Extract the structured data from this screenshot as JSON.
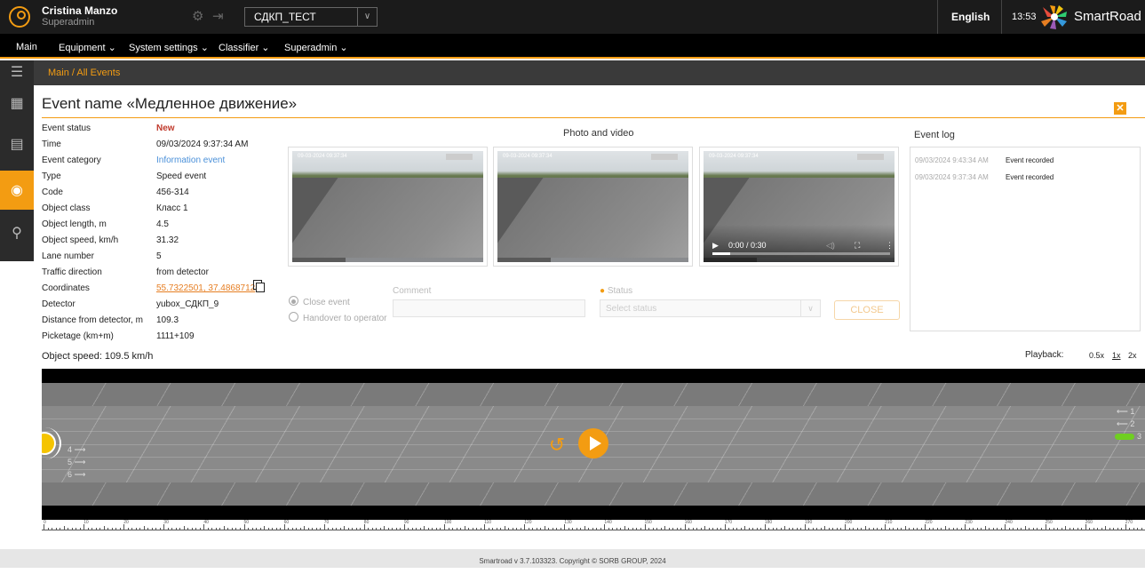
{
  "topbar": {
    "user_name": "Cristina Manzo",
    "user_role": "Superadmin",
    "project": "СДКП_ТЕСТ",
    "language": "English",
    "time": "13:53",
    "brand": "SmartRoad"
  },
  "nav": {
    "items": [
      "Main",
      "Equipment ⌄",
      "System settings ⌄",
      "Classifier ⌄",
      "Superadmin ⌄"
    ]
  },
  "breadcrumb": "Main / All Events",
  "event": {
    "title": "Event name «Медленное движение»",
    "properties": [
      {
        "label": "Event status",
        "value": "New",
        "style": "new"
      },
      {
        "label": "Time",
        "value": "09/03/2024 9:37:34 AM",
        "style": ""
      },
      {
        "label": "Event category",
        "value": "Information event",
        "style": "info"
      },
      {
        "label": "Type",
        "value": "Speed event",
        "style": ""
      },
      {
        "label": "Code",
        "value": "456-314",
        "style": ""
      },
      {
        "label": "Object class",
        "value": "Класс 1",
        "style": ""
      },
      {
        "label": "Object length, m",
        "value": "4.5",
        "style": ""
      },
      {
        "label": "Object speed, km/h",
        "value": "31.32",
        "style": ""
      },
      {
        "label": "Lane number",
        "value": "5",
        "style": ""
      },
      {
        "label": "Traffic direction",
        "value": "from detector",
        "style": ""
      },
      {
        "label": "Coordinates",
        "value": "55.7322501, 37.4868712",
        "style": "link"
      },
      {
        "label": "Detector",
        "value": "yubox_СДКП_9",
        "style": ""
      },
      {
        "label": "Distance from detector, m",
        "value": "109.3",
        "style": ""
      },
      {
        "label": "Picketage (km+m)",
        "value": "1111+109",
        "style": ""
      }
    ],
    "object_speed_note": "Object speed: 109.5 km/h"
  },
  "media": {
    "title": "Photo and video",
    "timestamp": "09-03-2024 09:37:34",
    "video_time": "0:00 / 0:30"
  },
  "action": {
    "close_event": "Close event",
    "handover": "Handover to operator",
    "comment_label": "Comment",
    "status_label": "Status",
    "status_placeholder": "Select status",
    "close_button": "CLOSE"
  },
  "log": {
    "title": "Event log",
    "entries": [
      {
        "time": "09/03/2024 9:43:34 AM",
        "text": "Event recorded"
      },
      {
        "time": "09/03/2024 9:37:34 AM",
        "text": "Event recorded"
      }
    ]
  },
  "playback": {
    "label": "Playback:",
    "options": [
      "0.5x",
      "1x",
      "2x"
    ],
    "selected": "1x"
  },
  "simulation": {
    "lanes_left": [
      "4",
      "5",
      "6"
    ],
    "lanes_right": [
      "1",
      "2",
      "3"
    ]
  },
  "ruler": {
    "labels": [
      "0",
      "10",
      "20",
      "30",
      "40",
      "50",
      "60",
      "70",
      "80",
      "90",
      "100",
      "110",
      "120",
      "130",
      "140",
      "150",
      "160",
      "170",
      "180",
      "190",
      "200",
      "210",
      "220",
      "230",
      "240",
      "250",
      "260",
      "270"
    ]
  },
  "footer": "Smartroad v 3.7.103323. Copyright © SORB GROUP, 2024",
  "colors": {
    "accent": "#f39c12",
    "status_new": "#c0392b",
    "info": "#4a90d9",
    "car": "#6fcf21"
  }
}
